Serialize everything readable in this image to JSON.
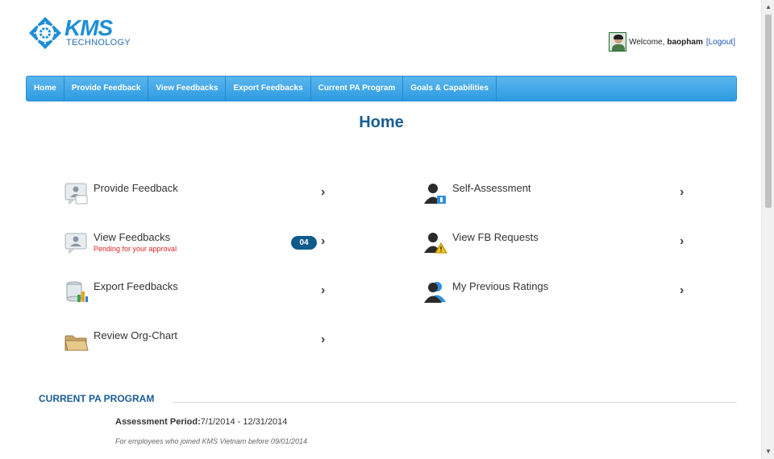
{
  "logo": {
    "brand": "KMS",
    "sub": "TECHNOLOGY"
  },
  "user": {
    "welcome": "Welcome,",
    "name": "baopham",
    "logout": "[Logout]"
  },
  "nav": [
    "Home",
    "Provide Feedback",
    "View Feedbacks",
    "Export Feedbacks",
    "Current PA Program",
    "Goals & Capabilities"
  ],
  "page_title": "Home",
  "menu": {
    "provide_feedback": {
      "label": "Provide Feedback",
      "icon": "provide-feedback-icon"
    },
    "view_feedbacks": {
      "label": "View Feedbacks",
      "sub": "Pending for your approval",
      "badge": "04",
      "icon": "view-feedbacks-icon"
    },
    "export_feedbacks": {
      "label": "Export Feedbacks",
      "icon": "export-feedbacks-icon"
    },
    "review_org_chart": {
      "label": "Review Org-Chart",
      "icon": "folder-icon"
    },
    "self_assessment": {
      "label": "Self-Assessment",
      "icon": "self-assessment-icon"
    },
    "view_fb_requests": {
      "label": "View FB Requests",
      "icon": "fb-requests-icon"
    },
    "my_previous_ratings": {
      "label": "My Previous Ratings",
      "icon": "previous-ratings-icon"
    }
  },
  "arrow": "›",
  "section": {
    "title": "CURRENT PA PROGRAM",
    "period_label": "Assessment Period:",
    "period_value": "7/1/2014 - 12/31/2014",
    "note": "For employees who joined KMS Vietnam before 09/01/2014"
  },
  "colors": {
    "nav": "#2d9be2",
    "title": "#1a5d92",
    "badge": "#0e5b8c",
    "alert": "#e02020"
  }
}
